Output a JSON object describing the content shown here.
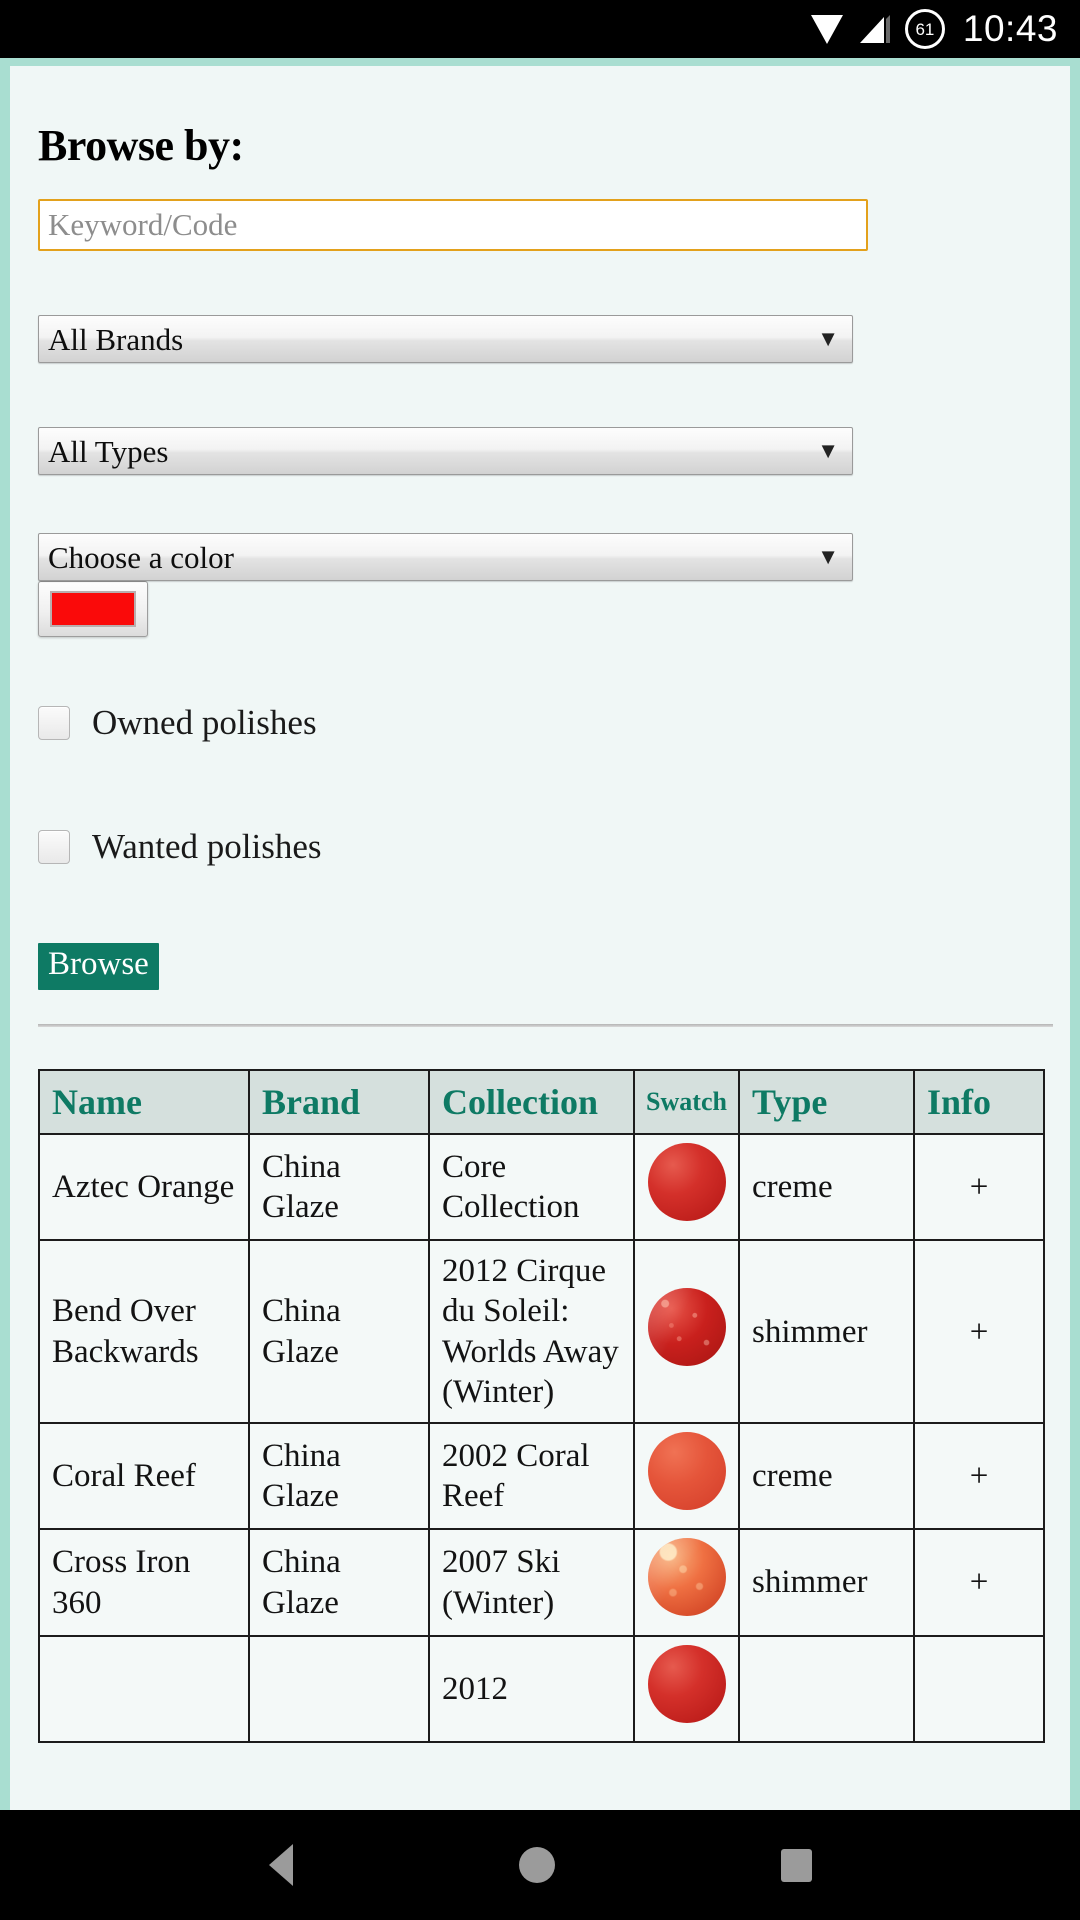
{
  "status_bar": {
    "wifi_icon": "wifi-icon",
    "signal_icon": "signal-icon",
    "battery_percent": "61",
    "time": "10:43"
  },
  "form": {
    "heading": "Browse by:",
    "keyword_placeholder": "Keyword/Code",
    "keyword_value": "",
    "brand_select": "All Brands",
    "type_select": "All Types",
    "color_select": "Choose a color",
    "color_swatch_hex": "#fa0a0a",
    "dropdown_arrow": "▼",
    "checkbox_owned": "Owned polishes",
    "checkbox_owned_checked": false,
    "checkbox_wanted": "Wanted polishes",
    "checkbox_wanted_checked": false,
    "browse_button": "Browse"
  },
  "theme": {
    "accent_teal": "#0e7a64",
    "frame_mint": "#a9ded1",
    "page_bg": "#f0f7f6",
    "input_focus_border": "#e3a11c",
    "table_header_bg": "#d5e0dd"
  },
  "table": {
    "headers": [
      "Name",
      "Brand",
      "Collection",
      "Swatch",
      "Type",
      "Info"
    ],
    "rows": [
      {
        "name": "Aztec Orange",
        "brand": "China Glaze",
        "collection": "Core Collection",
        "swatch_style": "swatch-creme-red",
        "type": "creme",
        "info": "+"
      },
      {
        "name": "Bend Over Backwards",
        "brand": "China Glaze",
        "collection": "2012 Cirque du Soleil: Worlds Away (Winter)",
        "swatch_style": "swatch-shimmer-red",
        "type": "shimmer",
        "info": "+"
      },
      {
        "name": "Coral Reef",
        "brand": "China Glaze",
        "collection": "2002 Coral Reef",
        "swatch_style": "swatch-coral",
        "type": "creme",
        "info": "+"
      },
      {
        "name": "Cross Iron 360",
        "brand": "China Glaze",
        "collection": "2007 Ski (Winter)",
        "swatch_style": "swatch-shimmer-coral",
        "type": "shimmer",
        "info": "+"
      },
      {
        "name": "",
        "brand": "",
        "collection": "2012",
        "swatch_style": "swatch-creme-red",
        "type": "",
        "info": ""
      }
    ]
  },
  "nav_bar": {
    "back": "back-icon",
    "home": "home-icon",
    "recents": "recents-icon"
  }
}
